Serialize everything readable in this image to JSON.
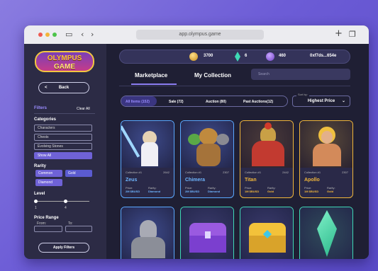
{
  "browser": {
    "url": "app.olympus.game"
  },
  "sidebar": {
    "logo_line1": "OLYMPUS",
    "logo_line2": "GAME",
    "back_label": "Back",
    "filters_title": "Filters",
    "clear_all": "Clear All",
    "categories_title": "Categories",
    "categories": [
      "Characters",
      "Chests",
      "Evolving Stones",
      "Show All"
    ],
    "rarity_title": "Rarity",
    "rarity": [
      "Common",
      "Gold",
      "Diamond"
    ],
    "level_title": "Level",
    "level_min": "1",
    "level_max": "4",
    "price_title": "Price Range",
    "price_from": "From:",
    "price_to": "To:",
    "apply_label": "Apply Filters"
  },
  "topbar": {
    "coins": "3700",
    "gems": "6",
    "crystals": "460",
    "wallet": "0xf7ds...654e"
  },
  "tabs": [
    "Marketplace",
    "My Collection"
  ],
  "search": {
    "placeholder": "Search"
  },
  "filters": [
    "All Items (152)",
    "Sale (72)",
    "Auction (80)",
    "Past Auctions(12)"
  ],
  "sort": {
    "label": "Sort by:",
    "value": "Highest Price"
  },
  "cards": [
    {
      "collection": "Collection #1",
      "id": "2642",
      "name": "Zeus",
      "price_label": "Price:",
      "rarity_label": "Rarity:",
      "price": "2M $BUSD",
      "rarity": "Diamond"
    },
    {
      "collection": "Collection #1",
      "id": "2307",
      "name": "Chimera",
      "price_label": "Price:",
      "rarity_label": "Rarity:",
      "price": "2M $BUSD",
      "rarity": "Diamond"
    },
    {
      "collection": "Collection #1",
      "id": "2442",
      "name": "Titan",
      "price_label": "Price:",
      "rarity_label": "Rarity:",
      "price": "1M $BUSD",
      "rarity": "Gold"
    },
    {
      "collection": "Collection #1",
      "id": "2307",
      "name": "Apollo",
      "price_label": "Price:",
      "rarity_label": "Rarity:",
      "price": "1M $BUSD",
      "rarity": "Gold"
    }
  ],
  "colors": {
    "diamond": "#6fb6ff",
    "gold": "#f1b63a",
    "accent": "#6f62d6"
  }
}
